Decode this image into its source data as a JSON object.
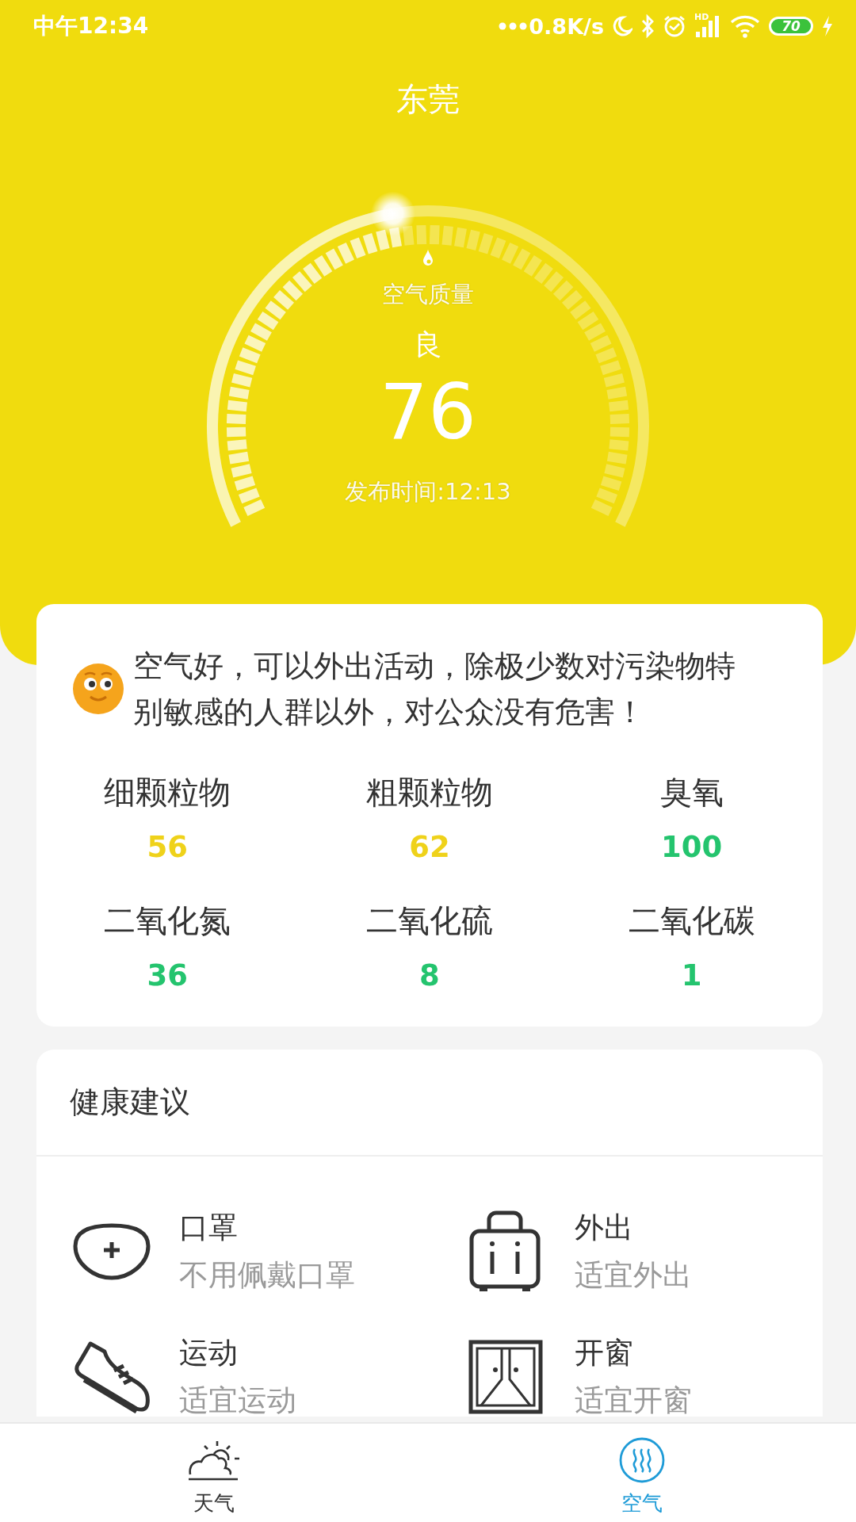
{
  "status_bar": {
    "time": "中午12:34",
    "net_speed": "0.8K/s",
    "network_type": "HD",
    "battery": "70"
  },
  "city": "东莞",
  "gauge": {
    "label": "空气质量",
    "grade": "良",
    "aqi": "76",
    "publish_time": "发布时间:12:13",
    "level": 0.46
  },
  "summary": {
    "message": "空气好，可以外出活动，除极少数对污染物特别敏感的人群以外，对公众没有危害！"
  },
  "pollutants": [
    {
      "name": "细颗粒物",
      "value": "56",
      "color": "#efd21a"
    },
    {
      "name": "粗颗粒物",
      "value": "62",
      "color": "#efd21a"
    },
    {
      "name": "臭氧",
      "value": "100",
      "color": "#24c46e"
    },
    {
      "name": "二氧化氮",
      "value": "36",
      "color": "#24c46e"
    },
    {
      "name": "二氧化硫",
      "value": "8",
      "color": "#24c46e"
    },
    {
      "name": "二氧化碳",
      "value": "1",
      "color": "#24c46e"
    }
  ],
  "health": {
    "title": "健康建议",
    "items": [
      {
        "kind": "mask",
        "title": "口罩",
        "advice": "不用佩戴口罩"
      },
      {
        "kind": "outing",
        "title": "外出",
        "advice": "适宜外出"
      },
      {
        "kind": "sport",
        "title": "运动",
        "advice": "适宜运动"
      },
      {
        "kind": "window",
        "title": "开窗",
        "advice": "适宜开窗"
      }
    ]
  },
  "tabs": [
    {
      "kind": "weather",
      "label": "天气",
      "selected": false
    },
    {
      "kind": "air",
      "label": "空气",
      "selected": true
    }
  ]
}
